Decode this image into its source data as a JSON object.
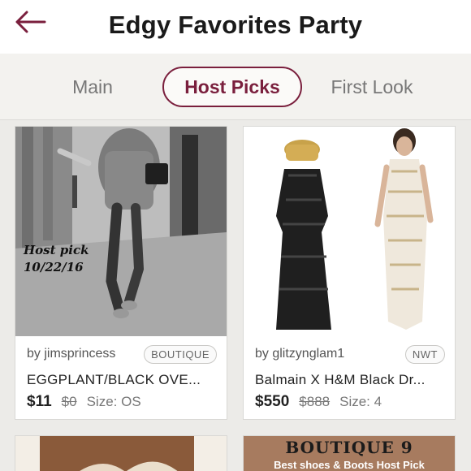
{
  "header": {
    "title": "Edgy Favorites Party",
    "back_icon": "back-arrow-icon",
    "accent_color": "#7a1f3d"
  },
  "tabs": [
    {
      "label": "Main",
      "active": false
    },
    {
      "label": "Host Picks",
      "active": true
    },
    {
      "label": "First Look",
      "active": false
    }
  ],
  "listings": [
    {
      "seller": "by jimsprincess",
      "badge": "BOUTIQUE",
      "title": "EGGPLANT/BLACK OVE...",
      "price": "$11",
      "original_price": "$0",
      "size": "Size: OS",
      "photo_text": [
        "Host pick",
        "10/22/16"
      ]
    },
    {
      "seller": "by glitzynglam1",
      "badge": "NWT",
      "title": "Balmain X H&M Black Dr...",
      "price": "$550",
      "original_price": "$888",
      "size": "Size: 4"
    },
    {
      "photo_text": []
    },
    {
      "photo_text": [
        "BOUTIQUE 9",
        "Best shoes & Boots Host Pick"
      ]
    }
  ]
}
